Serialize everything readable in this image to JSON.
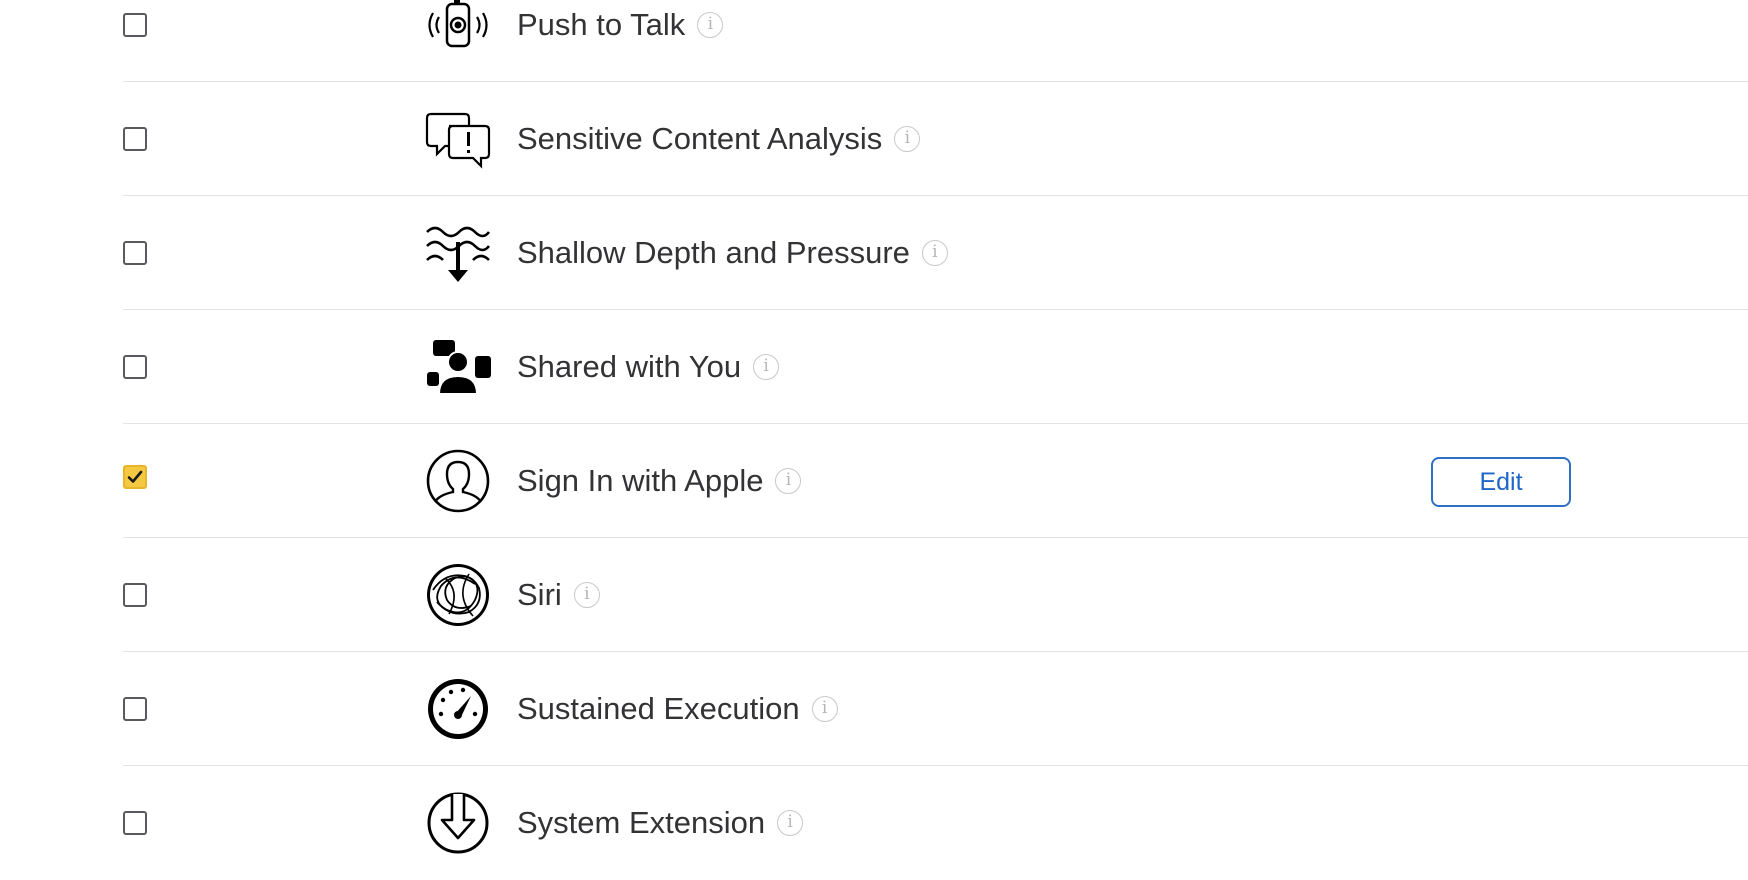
{
  "capabilities": [
    {
      "label": "Push to Talk",
      "checked": false,
      "icon": "push-to-talk-icon"
    },
    {
      "label": "Sensitive Content Analysis",
      "checked": false,
      "icon": "speech-bubbles-alert-icon"
    },
    {
      "label": "Shallow Depth and Pressure",
      "checked": false,
      "icon": "water-depth-icon"
    },
    {
      "label": "Shared with You",
      "checked": false,
      "icon": "shared-people-icon"
    },
    {
      "label": "Sign In with Apple",
      "checked": true,
      "icon": "person-circle-icon",
      "action_label": "Edit"
    },
    {
      "label": "Siri",
      "checked": false,
      "icon": "siri-icon"
    },
    {
      "label": "Sustained Execution",
      "checked": false,
      "icon": "gauge-icon"
    },
    {
      "label": "System Extension",
      "checked": false,
      "icon": "download-circle-icon"
    }
  ],
  "info_glyph": "i",
  "colors": {
    "checked_fill": "#f5c842",
    "link_blue": "#1f66c8",
    "separator": "#e3e3e6"
  }
}
